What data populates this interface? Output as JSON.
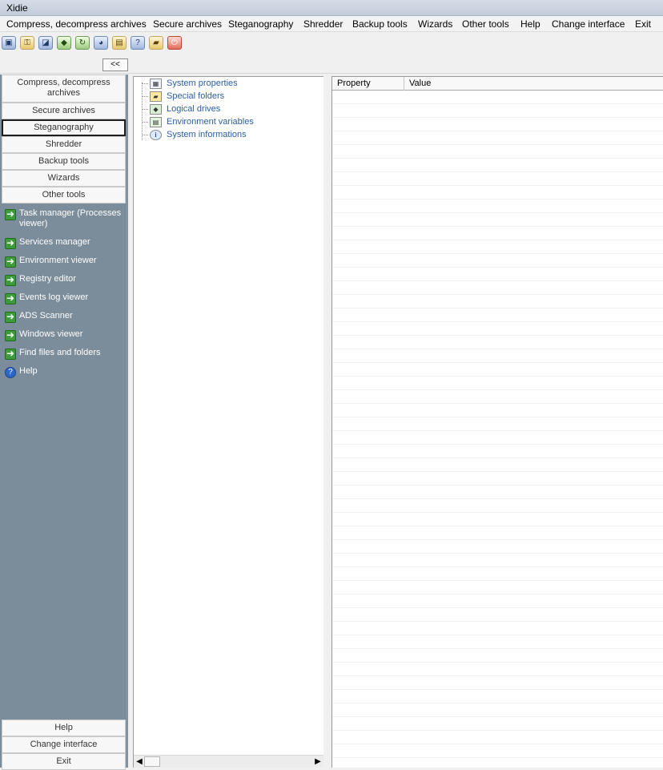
{
  "app": {
    "title": "Xidie"
  },
  "menu": [
    "Compress, decompress archives",
    "Secure archives",
    "Steganography",
    "Shredder",
    "Backup tools",
    "Wizards",
    "Other tools",
    "Help",
    "Change interface",
    "Exit"
  ],
  "toolbar": {
    "icons": [
      "compress-icon",
      "key-icon",
      "image-icon",
      "shield-icon",
      "recycle-icon",
      "users-icon",
      "archive-icon",
      "help-icon",
      "folder-icon",
      "power-icon"
    ],
    "collapse_label": "<<"
  },
  "sidebar": {
    "categories": [
      "Compress, decompress archives",
      "Secure archives",
      "Steganography",
      "Shredder",
      "Backup tools",
      "Wizards",
      "Other tools"
    ],
    "active_category": "Steganography",
    "tasks": [
      {
        "label": "Task manager (Processes viewer)",
        "icon": "arrow-icon"
      },
      {
        "label": "Services manager",
        "icon": "arrow-icon"
      },
      {
        "label": "Environment viewer",
        "icon": "arrow-icon"
      },
      {
        "label": "Registry editor",
        "icon": "arrow-icon"
      },
      {
        "label": "Events log viewer",
        "icon": "arrow-icon"
      },
      {
        "label": "ADS Scanner",
        "icon": "arrow-icon"
      },
      {
        "label": "Windows viewer",
        "icon": "arrow-icon"
      },
      {
        "label": "Find files and folders",
        "icon": "arrow-icon"
      },
      {
        "label": "Help",
        "icon": "help-icon"
      }
    ],
    "bottom_buttons": [
      "Help",
      "Change interface",
      "Exit"
    ]
  },
  "tree": {
    "items": [
      {
        "label": "System properties",
        "icon": "properties-icon"
      },
      {
        "label": "Special folders",
        "icon": "folder-icon"
      },
      {
        "label": "Logical drives",
        "icon": "drive-icon"
      },
      {
        "label": "Environment variables",
        "icon": "variables-icon"
      },
      {
        "label": "System informations",
        "icon": "info-icon"
      }
    ]
  },
  "grid": {
    "columns": [
      "Property",
      "Value"
    ]
  },
  "colors": {
    "sidebar": "#7b8c9a",
    "tree_text": "#2b5fa5",
    "task_icon": "#3f9a3b"
  }
}
